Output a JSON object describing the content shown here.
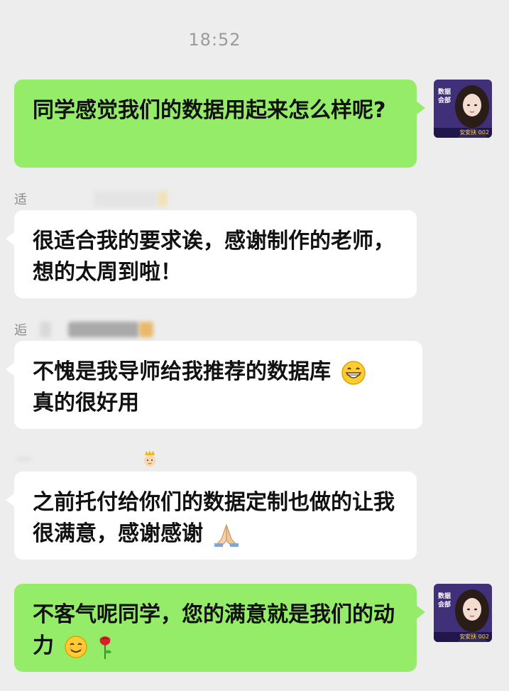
{
  "chat": {
    "timestamp": "18:52",
    "messages": [
      {
        "id": "m1",
        "direction": "out",
        "text": "同学感觉我们的数据用起来怎么样呢?"
      },
      {
        "id": "m2",
        "direction": "in",
        "sender_nick": "适",
        "text": "很适合我的要求诶，感谢制作的老师，想的太周到啦！"
      },
      {
        "id": "m3",
        "direction": "in",
        "sender_nick": "逅",
        "text": "不愧是我导师给我推荐的数据库",
        "text_line2": "真的很好用",
        "emoji": "grinning-face"
      },
      {
        "id": "m4",
        "direction": "in",
        "sender_nick": "",
        "text": "之前托付给你们的数据定制也做的让我很满意，感谢感谢",
        "emoji": "folded-hands"
      },
      {
        "id": "m5",
        "direction": "out",
        "text": "不客气呢同学，您的满意就是我们的动力",
        "emoji": "smiling-face,rose"
      }
    ]
  },
  "avatar": {
    "tag_text": "数据会部",
    "strip_text": "安安扶 002"
  },
  "colors": {
    "background": "#ededed",
    "outgoing_bubble": "#95ec69",
    "incoming_bubble": "#ffffff",
    "avatar_bg": "#40307a"
  }
}
